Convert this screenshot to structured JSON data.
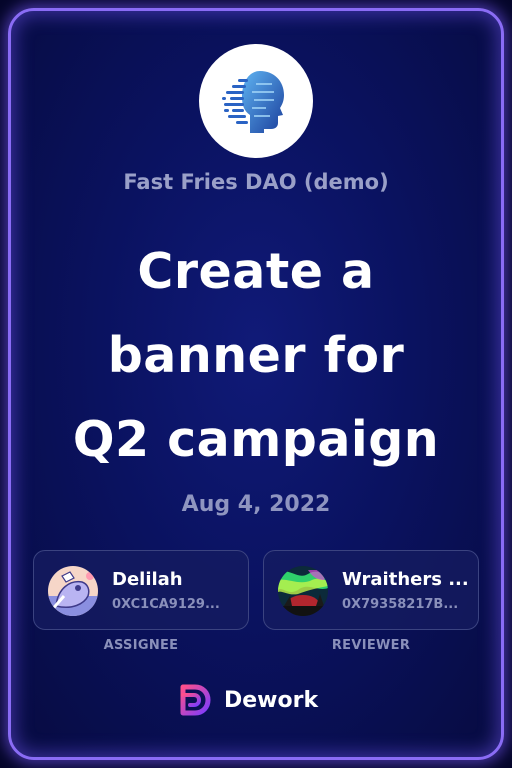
{
  "org": {
    "name": "Fast Fries DAO (demo)",
    "logo_icon": "ai-face-icon"
  },
  "task": {
    "title_lines": [
      "Create a",
      "banner for",
      "Q2 campaign"
    ],
    "date": "Aug 4, 2022"
  },
  "assignee": {
    "name": "Delilah",
    "address": "0XC1CA9129...",
    "role": "ASSIGNEE",
    "avatar_icon": "cartoon-avatar-icon"
  },
  "reviewer": {
    "name": "Wraithers ...",
    "address": "0X79358217B...",
    "role": "REVIEWER",
    "avatar_icon": "aurora-avatar-icon"
  },
  "brand": {
    "name": "Dework",
    "logo_icon": "dework-logo-icon"
  },
  "colors": {
    "card_border": "#8a6cf5",
    "card_background": "#0a1260",
    "muted_text": "#8f95c0",
    "brand_gradient_start": "#ff4f8b",
    "brand_gradient_end": "#7b3cff"
  }
}
